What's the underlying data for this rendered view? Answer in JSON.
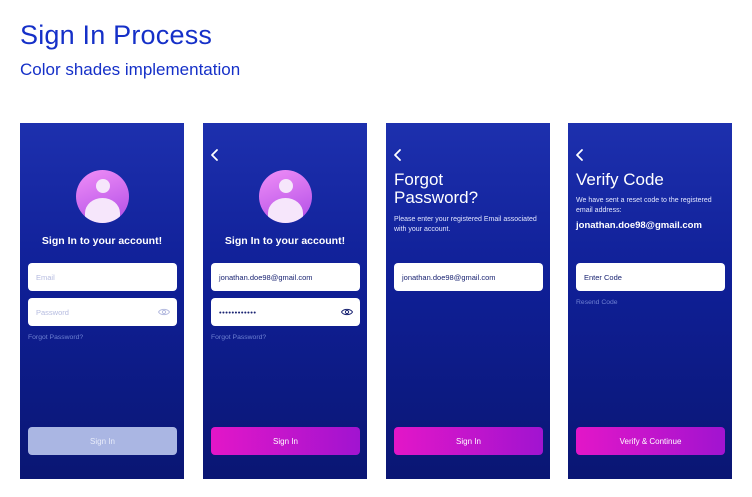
{
  "header": {
    "title": "Sign In Process",
    "subtitle": "Color shades implementation"
  },
  "colors": {
    "brand_blue": "#1530c8",
    "screen_top": "#1d30ae",
    "screen_bottom": "#0a1673",
    "button_gradient_start": "#e316c8",
    "button_gradient_end": "#a114d0",
    "button_disabled": "#aab6e3"
  },
  "screen1": {
    "heading": "Sign In to your account!",
    "email_placeholder": "Email",
    "password_placeholder": "Password",
    "forgot_link": "Forgot Password?",
    "button": "Sign In"
  },
  "screen2": {
    "heading": "Sign In to your account!",
    "email_value": "jonathan.doe98@gmail.com",
    "password_value": "••••••••••••",
    "forgot_link": "Forgot Password?",
    "button": "Sign In"
  },
  "screen3": {
    "title_line1": "Forgot",
    "title_line2": "Password?",
    "description": "Please enter your registered Email associated with your account.",
    "email_value": "jonathan.doe98@gmail.com",
    "button": "Sign In"
  },
  "screen4": {
    "title": "Verify Code",
    "description": "We have sent a reset code to the registered email address:",
    "email": "jonathan.doe98@gmail.com",
    "code_placeholder": "Enter Code",
    "resend_link": "Resend Code",
    "button": "Verify & Continue"
  },
  "icons": {
    "back": "chevron-left-icon",
    "avatar": "user-avatar-icon",
    "show_password": "eye-icon"
  }
}
